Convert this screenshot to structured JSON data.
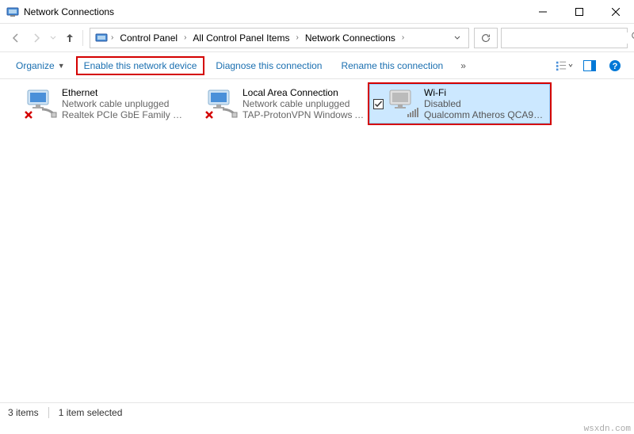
{
  "window": {
    "title": "Network Connections"
  },
  "breadcrumbs": [
    "Control Panel",
    "All Control Panel Items",
    "Network Connections"
  ],
  "toolbar": {
    "organize": "Organize",
    "enable": "Enable this network device",
    "diagnose": "Diagnose this connection",
    "rename": "Rename this connection"
  },
  "connections": [
    {
      "name": "Ethernet",
      "status": "Network cable unplugged",
      "device": "Realtek PCIe GbE Family Cont..."
    },
    {
      "name": "Local Area Connection",
      "status": "Network cable unplugged",
      "device": "TAP-ProtonVPN Windows Ad..."
    },
    {
      "name": "Wi-Fi",
      "status": "Disabled",
      "device": "Qualcomm Atheros QCA9377..."
    }
  ],
  "status": {
    "count": "3 items",
    "selected": "1 item selected"
  },
  "watermark": "wsxdn.com"
}
